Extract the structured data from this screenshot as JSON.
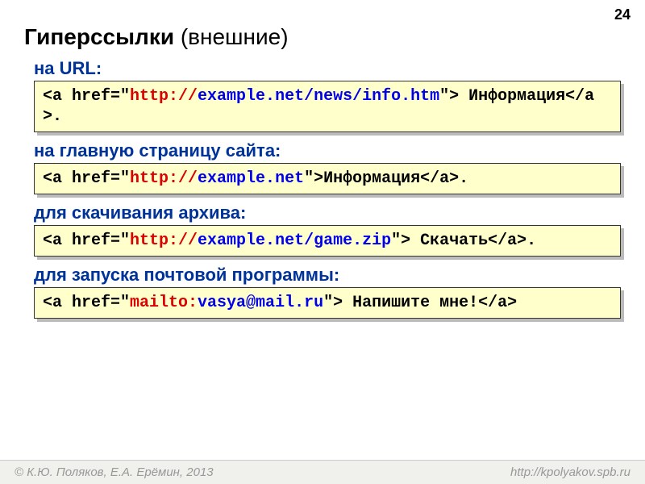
{
  "page_number": "24",
  "title": {
    "bold": "Гиперссылки",
    "rest": " (внешние)"
  },
  "sections": [
    {
      "label": "на URL:",
      "code": [
        {
          "t": "<a href=\"",
          "c": "black"
        },
        {
          "t": "http://",
          "c": "red"
        },
        {
          "t": "example.net/news/info.htm",
          "c": "blue"
        },
        {
          "t": "\"> Информация</a>.",
          "c": "black"
        }
      ]
    },
    {
      "label": "на главную страницу сайта:",
      "code": [
        {
          "t": "<a href=\"",
          "c": "black"
        },
        {
          "t": "http://",
          "c": "red"
        },
        {
          "t": "example.net",
          "c": "blue"
        },
        {
          "t": "\">Информация</a>.",
          "c": "black"
        }
      ]
    },
    {
      "label": "для скачивания архива:",
      "code": [
        {
          "t": "<a href=\"",
          "c": "black"
        },
        {
          "t": "http://",
          "c": "red"
        },
        {
          "t": "example.net/game.zip",
          "c": "blue"
        },
        {
          "t": "\"> Скачать</a>.",
          "c": "black"
        }
      ]
    },
    {
      "label": "для запуска почтовой программы:",
      "code": [
        {
          "t": "<a href=\"",
          "c": "black"
        },
        {
          "t": "mailto:",
          "c": "red"
        },
        {
          "t": "vasya@mail.ru",
          "c": "blue"
        },
        {
          "t": "\"> Напишите мне!</a>",
          "c": "black"
        }
      ]
    }
  ],
  "footer": {
    "left": "© К.Ю. Поляков, Е.А. Ерёмин, 2013",
    "right": "http://kpolyakov.spb.ru"
  }
}
